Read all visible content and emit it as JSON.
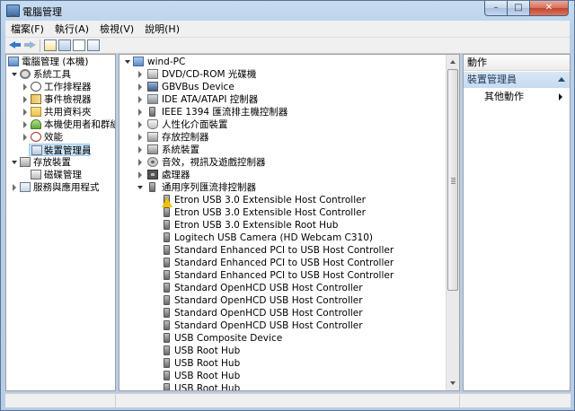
{
  "window": {
    "title": "電腦管理",
    "caption_min": "–",
    "caption_max": "□",
    "caption_close": "✕"
  },
  "menu": [
    {
      "label": "檔案(F)"
    },
    {
      "label": "執行(A)"
    },
    {
      "label": "檢視(V)"
    },
    {
      "label": "說明(H)"
    }
  ],
  "toolbar": {
    "buttons": [
      "back-icon",
      "forward-icon",
      "console-tree-icon",
      "properties-icon",
      "help-icon",
      "window-icon"
    ]
  },
  "left_tree": [
    {
      "label": "電腦管理 (本機)"
    },
    {
      "label": "系統工具"
    },
    {
      "label": "工作排程器"
    },
    {
      "label": "事件檢視器"
    },
    {
      "label": "共用資料夾"
    },
    {
      "label": "本機使用者和群組"
    },
    {
      "label": "效能"
    },
    {
      "label": "裝置管理員"
    },
    {
      "label": "存放裝置"
    },
    {
      "label": "磁碟管理"
    },
    {
      "label": "服務與應用程式"
    }
  ],
  "device_tree": {
    "root": "wind-PC",
    "categories": [
      {
        "label": "DVD/CD-ROM 光碟機"
      },
      {
        "label": "GBVBus Device"
      },
      {
        "label": "IDE ATA/ATAPI 控制器"
      },
      {
        "label": "IEEE 1394 匯流排主機控制器"
      },
      {
        "label": "人性化介面裝置"
      },
      {
        "label": "存放控制器"
      },
      {
        "label": "系統裝置"
      },
      {
        "label": "音效，視訊及遊戲控制器"
      },
      {
        "label": "處理器"
      },
      {
        "label": "通用序列匯流排控制器"
      }
    ],
    "usb_devices": [
      {
        "label": "Etron USB 3.0 Extensible Host Controller",
        "warning": true
      },
      {
        "label": "Etron USB 3.0 Extensible Host Controller",
        "warning": false
      },
      {
        "label": "Etron USB 3.0 Extensible Root Hub",
        "warning": false
      },
      {
        "label": "Logitech USB Camera (HD Webcam C310)",
        "warning": false
      },
      {
        "label": "Standard Enhanced PCI to USB Host Controller",
        "warning": false
      },
      {
        "label": "Standard Enhanced PCI to USB Host Controller",
        "warning": false
      },
      {
        "label": "Standard Enhanced PCI to USB Host Controller",
        "warning": false
      },
      {
        "label": "Standard OpenHCD USB Host Controller",
        "warning": false
      },
      {
        "label": "Standard OpenHCD USB Host Controller",
        "warning": false
      },
      {
        "label": "Standard OpenHCD USB Host Controller",
        "warning": false
      },
      {
        "label": "Standard OpenHCD USB Host Controller",
        "warning": false
      },
      {
        "label": "USB Composite Device",
        "warning": false
      },
      {
        "label": "USB Root Hub",
        "warning": false
      },
      {
        "label": "USB Root Hub",
        "warning": false
      },
      {
        "label": "USB Root Hub",
        "warning": false
      },
      {
        "label": "USB Root Hub",
        "warning": false
      }
    ]
  },
  "actions": {
    "header": "動作",
    "section": "裝置管理員",
    "more": "其他動作"
  },
  "colors": {
    "selection": "#cce4f7",
    "accent": "#2f79c8",
    "warning": "#f2c200"
  }
}
